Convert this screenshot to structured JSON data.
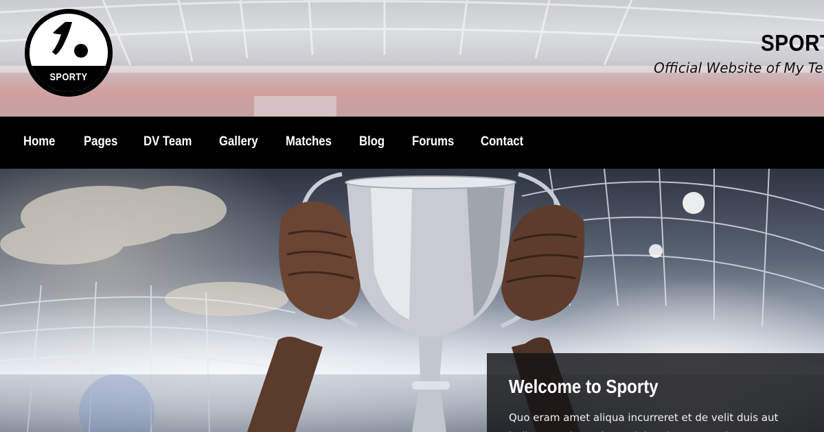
{
  "header": {
    "logo_text": "SPORTY",
    "site_title": "SPORTY",
    "tagline": "Official Website of My Team"
  },
  "nav": {
    "items": [
      {
        "label": "Home"
      },
      {
        "label": "Pages"
      },
      {
        "label": "DV Team"
      },
      {
        "label": "Gallery"
      },
      {
        "label": "Matches"
      },
      {
        "label": "Blog"
      },
      {
        "label": "Forums"
      },
      {
        "label": "Contact"
      }
    ]
  },
  "hero": {
    "welcome_title": "Welcome to Sporty",
    "welcome_text": "Quo eram amet aliqua incurreret et de velit duis aut iudicem. Culpa culpa tetigit enim commodo quae sunt"
  },
  "colors": {
    "nav_background": "#000000",
    "nav_text": "#ffffff",
    "welcome_box": "#141416"
  }
}
